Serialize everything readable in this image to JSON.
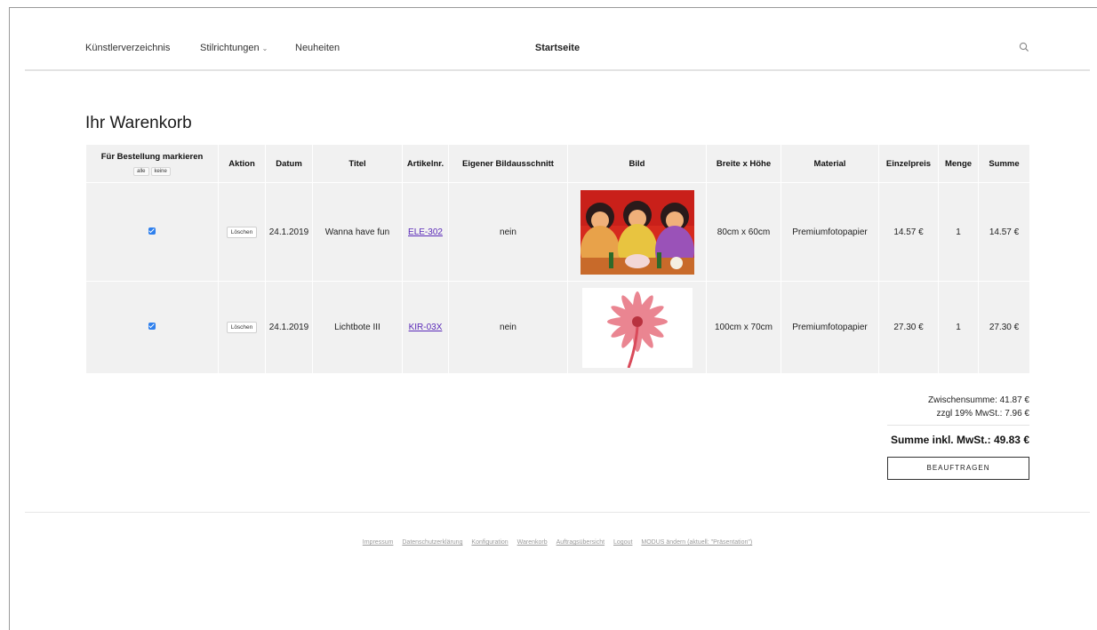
{
  "nav": {
    "items": [
      {
        "label": "Künstlerverzeichnis"
      },
      {
        "label": "Stilrichtungen"
      },
      {
        "label": "Neuheiten"
      }
    ],
    "center_title": "Startseite",
    "search_icon": "search-icon"
  },
  "page_title": "Ihr Warenkorb",
  "table": {
    "headers": {
      "mark": "Für Bestellung markieren",
      "mark_all": "alle",
      "mark_none": "keine",
      "action": "Aktion",
      "date": "Datum",
      "title": "Titel",
      "article": "Artikelnr.",
      "crop": "Eigener Bildausschnitt",
      "image": "Bild",
      "size": "Breite x Höhe",
      "material": "Material",
      "unit_price": "Einzelpreis",
      "qty": "Menge",
      "sum": "Summe"
    },
    "rows": [
      {
        "checked": true,
        "action": "Löschen",
        "date": "24.1.2019",
        "title": "Wanna have fun",
        "article": "ELE-302",
        "crop": "nein",
        "size": "80cm x 60cm",
        "material": "Premiumfotopapier",
        "unit_price": "14.57 €",
        "qty": "1",
        "sum": "14.57 €"
      },
      {
        "checked": true,
        "action": "Löschen",
        "date": "24.1.2019",
        "title": "Lichtbote III",
        "article": "KIR-03X",
        "crop": "nein",
        "size": "100cm x 70cm",
        "material": "Premiumfotopapier",
        "unit_price": "27.30 €",
        "qty": "1",
        "sum": "27.30 €"
      }
    ]
  },
  "totals": {
    "subtotal": "Zwischensumme: 41.87 €",
    "vat": "zzgl 19% MwSt.: 7.96 €",
    "grand": "Summe inkl. MwSt.: 49.83 €",
    "order_button": "BEAUFTRAGEN"
  },
  "footer": {
    "links": [
      "Impressum",
      "Datenschutzerklärung",
      "Konfiguration",
      "Warenkorb",
      "Auftragsübersicht",
      "Logout",
      "MODUS ändern (aktuell: \"Präsentation\")"
    ]
  },
  "colors": {
    "checkbox": "#2f80ed",
    "link": "#5a2ab8",
    "table_bg": "#f1f1f1"
  }
}
